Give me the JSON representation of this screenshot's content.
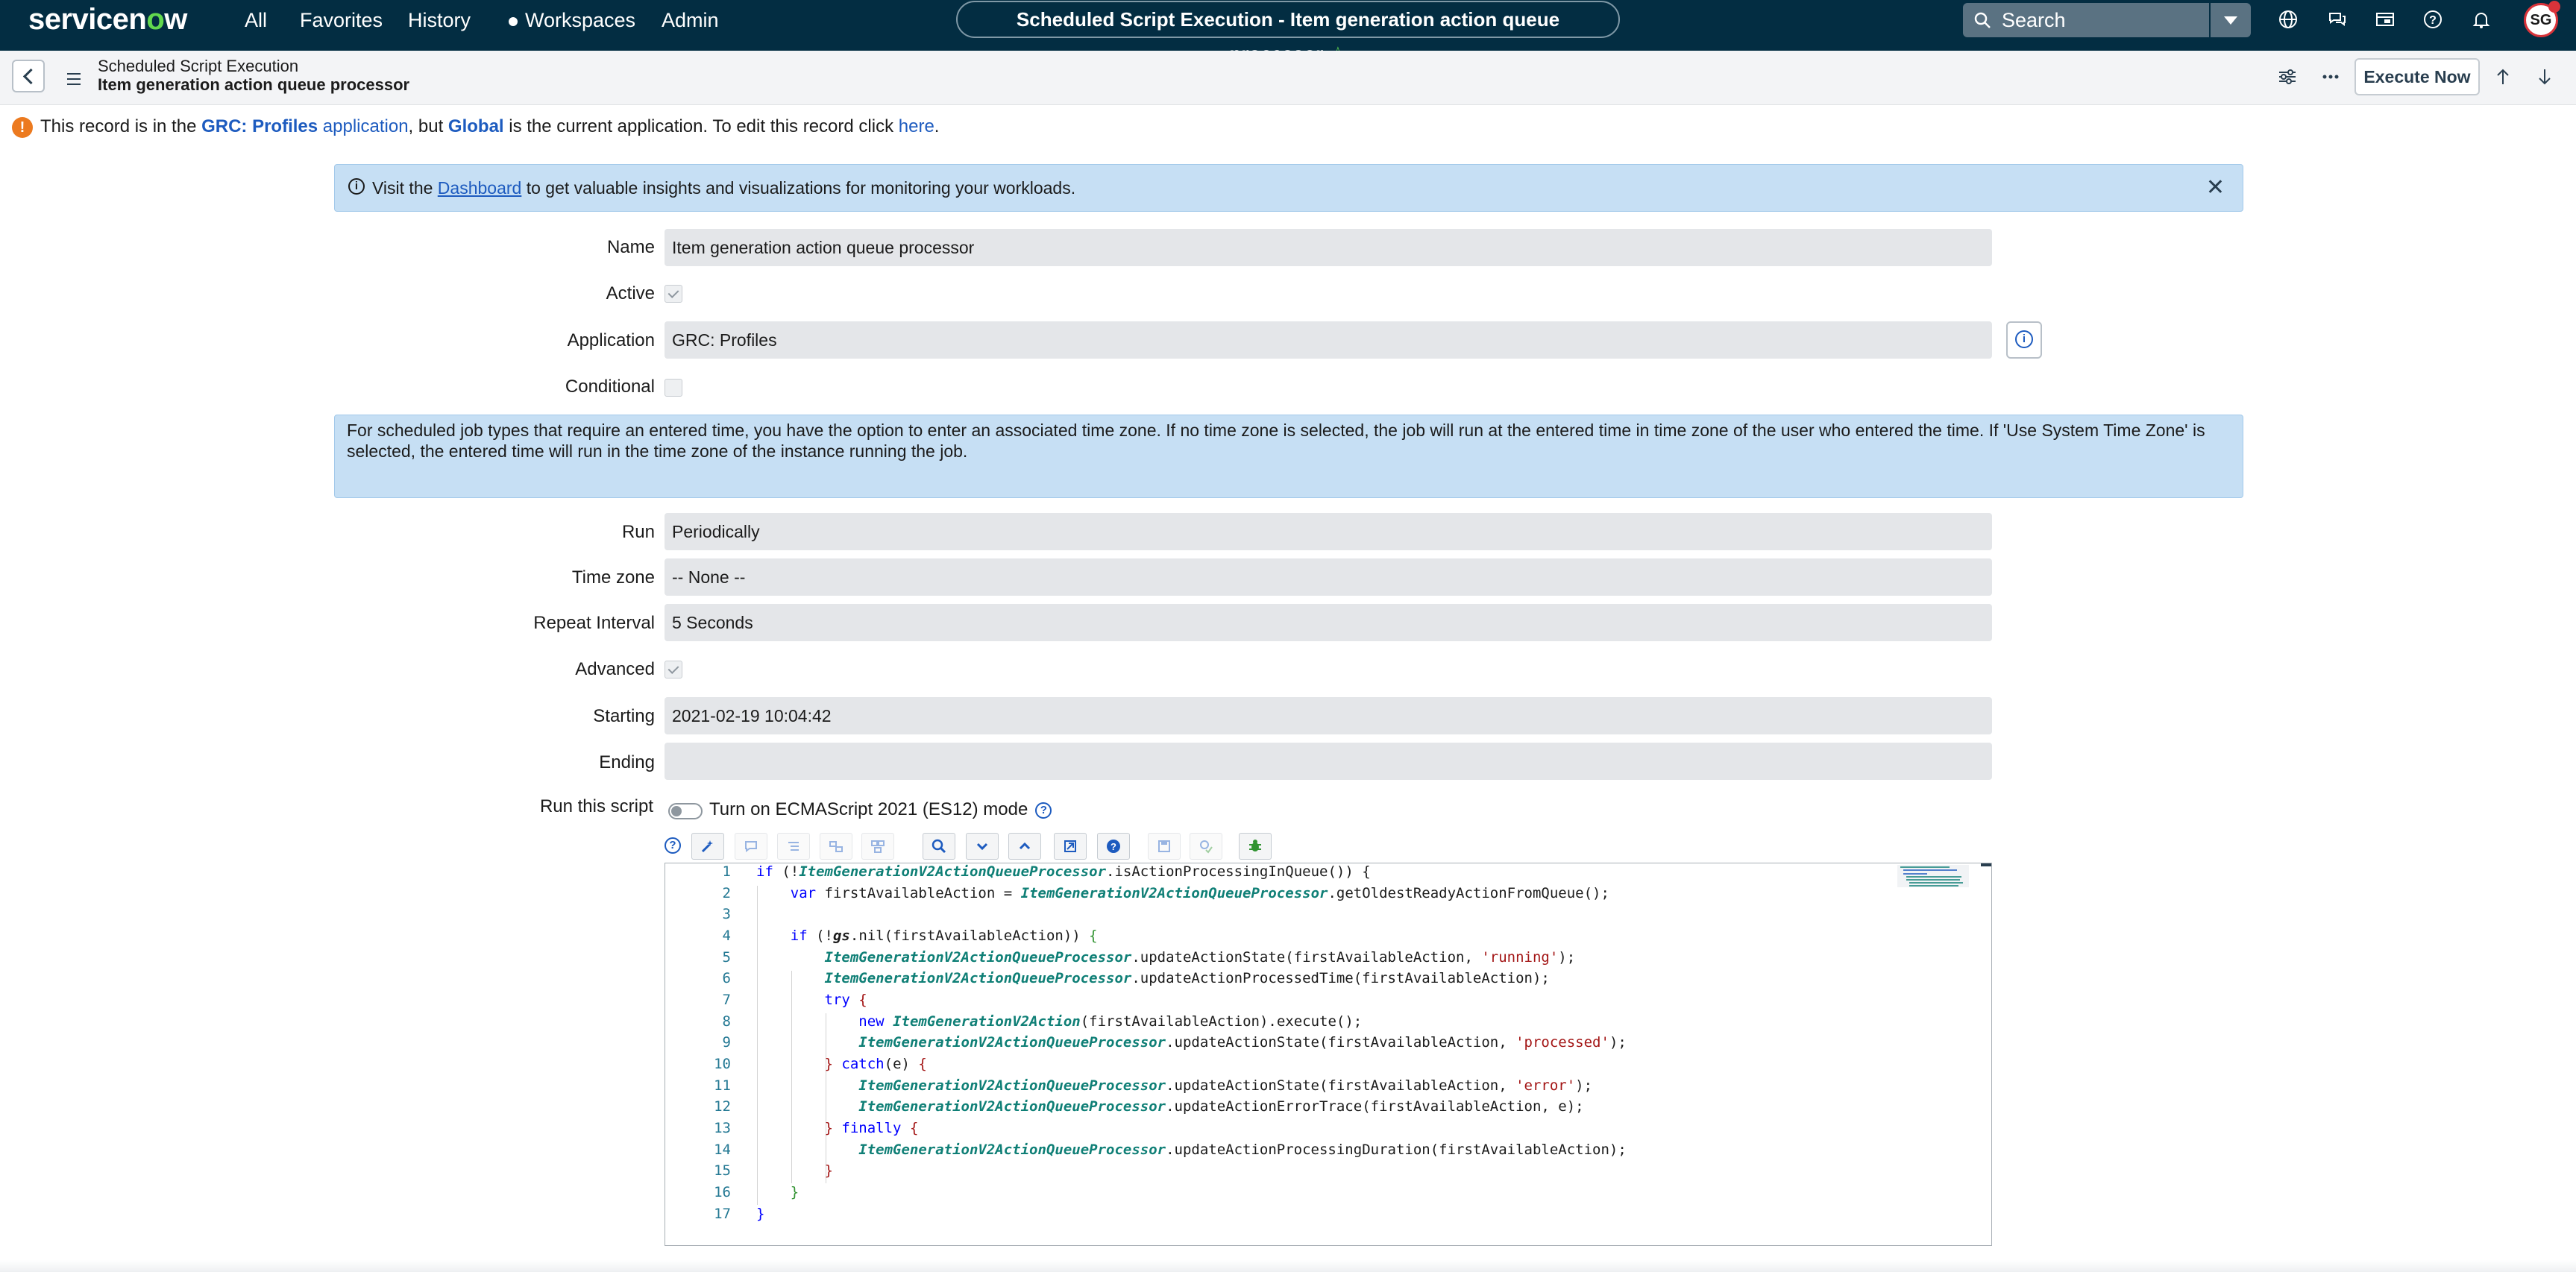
{
  "nav": {
    "logo_prefix": "servicen",
    "logo_o": "o",
    "logo_suffix": "w",
    "items": [
      "All",
      "Favorites",
      "History",
      "Workspaces",
      "Admin"
    ],
    "title": "Scheduled Script Execution - Item generation action queue processor",
    "search_placeholder": "Search",
    "avatar_initials": "SG",
    "icons": [
      "globe-icon",
      "chat-icon",
      "showcase-icon",
      "help-icon",
      "bell-icon"
    ]
  },
  "header": {
    "table": "Scheduled Script Execution",
    "record": "Item generation action queue processor",
    "execute_label": "Execute Now",
    "icons": [
      "settings-sliders-icon",
      "more-icon",
      "arrow-up-icon",
      "arrow-down-icon"
    ]
  },
  "notice": {
    "pre": "This record is in the",
    "app_name": "GRC: Profiles",
    "app_word": "application",
    "mid": ", but",
    "current": "Global",
    "post": "is the current application. To edit this record click",
    "here": "here",
    "end": "."
  },
  "banner": {
    "pre": "Visit the",
    "link": "Dashboard",
    "post": "to get valuable insights and visualizations for monitoring your workloads.",
    "close": "✕"
  },
  "timezone_info": "For scheduled job types that require an entered time, you have the option to enter an associated time zone. If no time zone is selected, the job will run at the entered time in time zone of the user who entered the time. If 'Use System Time Zone' is selected, the entered time will run in the time zone of the instance running the job.",
  "form": {
    "name_label": "Name",
    "name_value": "Item generation action queue processor",
    "active_label": "Active",
    "active_checked": true,
    "application_label": "Application",
    "application_value": "GRC: Profiles",
    "conditional_label": "Conditional",
    "conditional_checked": false,
    "run_label": "Run",
    "run_value": "Periodically",
    "timezone_label": "Time zone",
    "timezone_value": "-- None --",
    "repeat_label": "Repeat Interval",
    "repeat_value": "5 Seconds",
    "advanced_label": "Advanced",
    "advanced_checked": true,
    "starting_label": "Starting",
    "starting_value": "2021-02-19 10:04:42",
    "ending_label": "Ending",
    "ending_value": "",
    "script_label": "Run this script",
    "es12_label": "Turn on ECMAScript 2021 (ES12) mode",
    "es12_on": false
  },
  "editor": {
    "toolbar_icons": [
      "toggle-comment-icon",
      "format-code-icon",
      "replace-icon",
      "replace-all-icon",
      "fullscreen-icon",
      "search-icon",
      "next-icon",
      "previous-icon",
      "scripting-assistant-icon",
      "help-icon",
      "save-icon",
      "syntax-check-icon",
      "debug-icon"
    ],
    "line_numbers": [
      "1",
      "2",
      "3",
      "4",
      "5",
      "6",
      "7",
      "8",
      "9",
      "10",
      "11",
      "12",
      "13",
      "14",
      "15",
      "16",
      "17"
    ]
  }
}
